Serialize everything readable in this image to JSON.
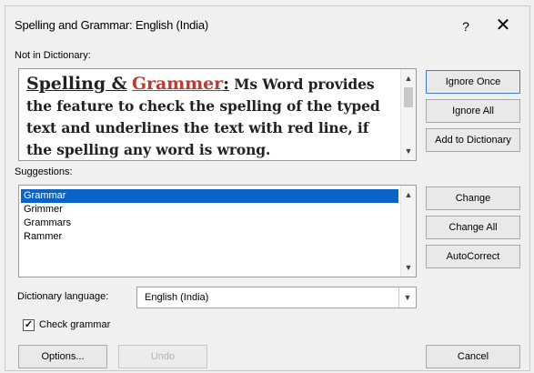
{
  "dialog": {
    "title": "Spelling and Grammar: English (India)",
    "help_glyph": "?",
    "close_glyph": "✕"
  },
  "not_in_dictionary": {
    "label": "Not in Dictionary:",
    "word1": "Spelling &",
    "error_word": "Grammer",
    "word3": ":",
    "rest": " Ms Word provides the feature to check the spelling of the typed text and underlines the text with red line, if the spelling any word is wrong."
  },
  "suggestions": {
    "label": "Suggestions:",
    "items": [
      "Grammar",
      "Grimmer",
      "Grammars",
      "Rammer"
    ],
    "selected_index": 0
  },
  "buttons": {
    "ignore_once": "Ignore Once",
    "ignore_all": "Ignore All",
    "add_to_dictionary": "Add to Dictionary",
    "change": "Change",
    "change_all": "Change All",
    "autocorrect": "AutoCorrect",
    "options": "Options...",
    "undo": "Undo",
    "cancel": "Cancel"
  },
  "dictionary_language": {
    "label": "Dictionary language:",
    "value": "English (India)"
  },
  "check_grammar": {
    "label": "Check grammar",
    "checked": true,
    "mark": "✓"
  },
  "scroll_glyphs": {
    "up": "▲",
    "down": "▼",
    "dropdown": "▼"
  }
}
